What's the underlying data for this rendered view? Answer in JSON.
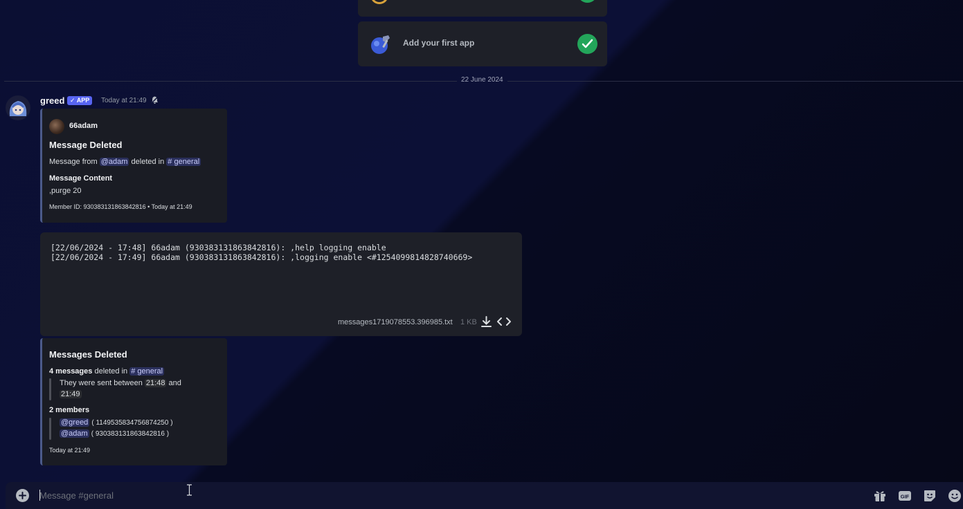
{
  "onboarding": {
    "add_app_label": "Add your first app"
  },
  "divider": {
    "date": "22 June 2024"
  },
  "message": {
    "author": "greed",
    "badge": "APP",
    "timestamp": "Today at 21:49"
  },
  "embed_deleted": {
    "author": "66adam",
    "title": "Message Deleted",
    "line_prefix": "Message from",
    "mention_user": "@adam",
    "line_middle": "deleted in",
    "channel": "# general",
    "content_label": "Message Content",
    "content_value": ",purge 20",
    "footer": "Member ID: 930383131863842816 • Today at 21:49"
  },
  "file": {
    "lines": [
      "[22/06/2024 - 17:48] 66adam (930383131863842816): ,help logging enable",
      "[22/06/2024 - 17:49] 66adam (930383131863842816): ,logging enable <#1254099814828740669>"
    ],
    "name": "messages1719078553.396985.txt",
    "size": "1 KB"
  },
  "embed_bulk": {
    "title": "Messages Deleted",
    "count_bold": "4 messages",
    "count_rest": "deleted in",
    "channel": "# general",
    "range_prefix": "They were sent between",
    "range_start": "21:48",
    "range_and": "and",
    "range_end": "21:49",
    "members_label": "2 members",
    "members": [
      {
        "mention": "@greed",
        "id": "( 1149535834756874250 )"
      },
      {
        "mention": "@adam",
        "id": "( 930383131863842816 )"
      }
    ],
    "footer": "Today at 21:49"
  },
  "composer": {
    "placeholder": "Message #general"
  },
  "icons": {
    "plus": "plus-circle-icon",
    "gift": "gift-icon",
    "gif": "gif-icon",
    "sticker": "sticker-icon",
    "emoji": "emoji-icon",
    "download": "download-icon",
    "code": "code-icon",
    "bell": "bell-muted-icon",
    "check": "check-icon"
  },
  "colors": {
    "accent": "#5865f2",
    "success": "#23a55a",
    "mention_bg": "#3a4282"
  }
}
